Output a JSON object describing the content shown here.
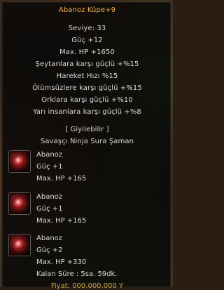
{
  "tooltip": {
    "title": "Abanoz Küpe+9",
    "level": "Seviye: 33",
    "stats": [
      "Güç +12",
      "Max. HP +1650",
      "Şeytanlara karşı güçlü +%15",
      "Hareket Hızı %15",
      "Ölümsüzlere karşı güçlü +%15",
      "Orklara karşı güçlü +%10",
      "Yarı insanlara karşı güçlü +%8"
    ],
    "wearable_header": "[ Giyilebilir ]",
    "classes": "Savaşçı Ninja Sura Şaman",
    "sockets": [
      {
        "name": "Abanoz",
        "lines": [
          "Güç +1",
          "Max. HP +165"
        ]
      },
      {
        "name": "Abanoz",
        "lines": [
          "Güç +1",
          "Max. HP +165"
        ]
      },
      {
        "name": "Abanoz",
        "lines": [
          "Güç +2",
          "Max. HP +330",
          "Kalan Süre : 5sa. 59dk."
        ]
      }
    ],
    "footer_partial": "Fiyat: 000.000.000 Y"
  },
  "colors": {
    "title": "#f3b24a",
    "text": "#d9d9d9",
    "footer": "#c9a848"
  }
}
